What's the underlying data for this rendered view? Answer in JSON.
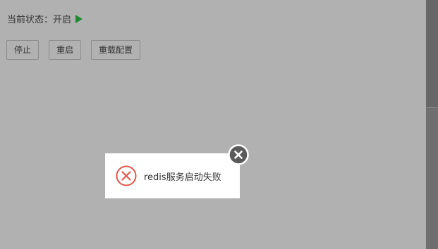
{
  "status": {
    "label": "当前状态：",
    "value": "开启",
    "icon": "play-icon",
    "icon_color": "#1e8a2f"
  },
  "buttons": {
    "stop": "停止",
    "restart": "重启",
    "reload_config": "重载配置"
  },
  "toast": {
    "message": "redis服务启动失败",
    "icon": "error-circle-icon",
    "icon_color": "#e4574a",
    "close_icon": "close-icon"
  }
}
